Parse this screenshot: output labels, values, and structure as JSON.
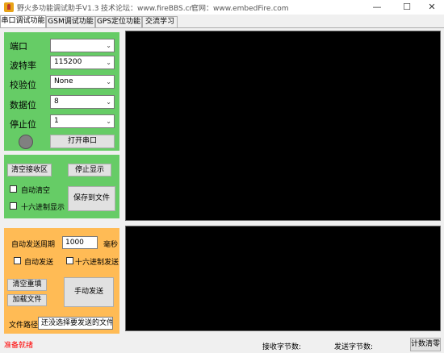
{
  "window": {
    "title": "野火多功能调试助手V1.3",
    "forum": "技术论坛：www.fireBBS.cn",
    "website": "官网：www.embedFire.com",
    "minimize": "—",
    "maximize": "☐",
    "close": "✕"
  },
  "tabs": [
    "串口调试功能",
    "GSM调试功能",
    "GPS定位功能",
    "交流学习"
  ],
  "serial": {
    "port_label": "端口",
    "port_value": "",
    "baud_label": "波特率",
    "baud_value": "115200",
    "parity_label": "校验位",
    "parity_value": "None",
    "databits_label": "数据位",
    "databits_value": "8",
    "stopbits_label": "停止位",
    "stopbits_value": "1",
    "open_button": "打开串口",
    "dropdown_arrow": "⌄"
  },
  "receive": {
    "clear_button": "清空接收区",
    "stop_button": "停止显示",
    "auto_clear": "自动清空",
    "hex_display": "十六进制显示",
    "save_button": "保存到文件"
  },
  "send": {
    "period_label": "自动发送周期",
    "period_value": "1000",
    "period_unit": "毫秒",
    "auto_send": "自动发送",
    "hex_send": "十六进制发送",
    "clear_refill_button": "清空重填",
    "load_file_button": "加载文件",
    "manual_send_button": "手动发送",
    "file_path_label": "文件路径",
    "file_path_value": "还没选择要发送的文件"
  },
  "status": {
    "ready": "准备就绪",
    "rx_label": "接收字节数:",
    "tx_label": "发送字节数:",
    "reset_button": "计数清零"
  },
  "colors": {
    "ready_text": "#ff0000",
    "green_panel": "#66cc66",
    "orange_panel": "#ffbb55"
  }
}
